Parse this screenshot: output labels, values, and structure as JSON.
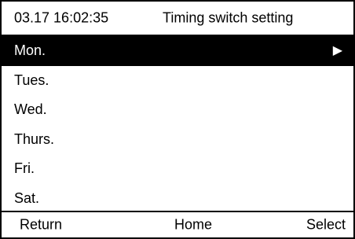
{
  "header": {
    "datetime": "03.17 16:02:35",
    "title": "Timing switch setting"
  },
  "menu": {
    "selected_index": 0,
    "items": [
      {
        "label": "Mon.",
        "selected": true,
        "arrow": "▶"
      },
      {
        "label": "Tues."
      },
      {
        "label": "Wed."
      },
      {
        "label": "Thurs."
      },
      {
        "label": "Fri."
      },
      {
        "label": "Sat."
      }
    ]
  },
  "footer": {
    "return_label": "Return",
    "home_label": "Home",
    "select_label": "Select"
  },
  "colors": {
    "background": "#ffffff",
    "foreground": "#000000",
    "highlight_bg": "#000000",
    "highlight_fg": "#ffffff"
  }
}
